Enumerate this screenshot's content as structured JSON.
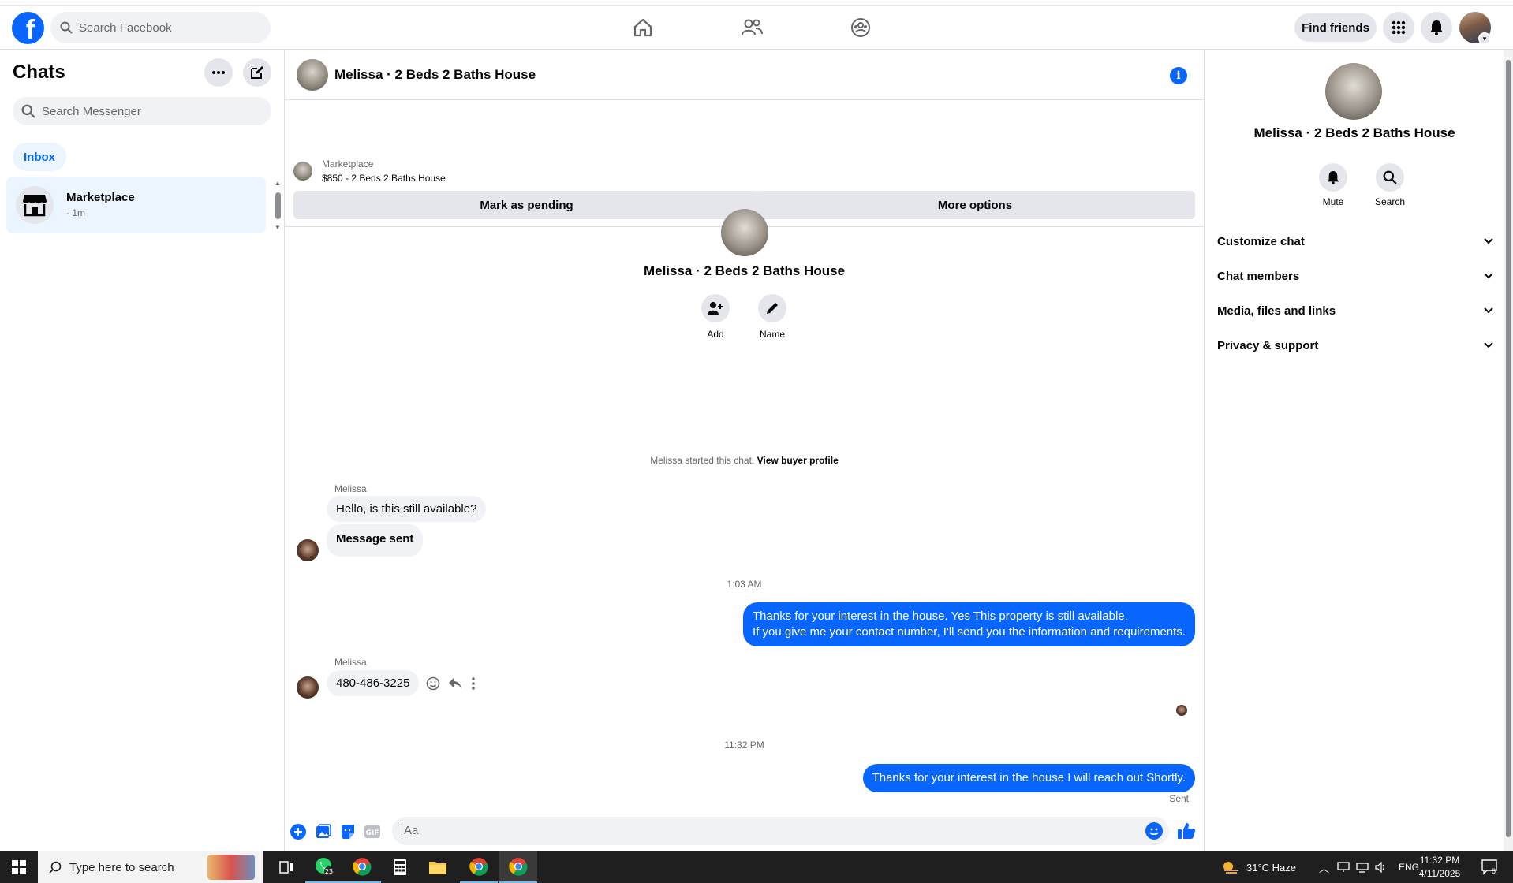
{
  "nav": {
    "logo": "f",
    "search_placeholder": "Search Facebook",
    "find_friends": "Find friends"
  },
  "left": {
    "title": "Chats",
    "search_placeholder": "Search Messenger",
    "inbox": "Inbox",
    "chat_item": {
      "name": "Marketplace",
      "time": "· 1m"
    }
  },
  "conversation": {
    "title": "Melissa · 2 Beds 2 Baths House",
    "marketplace_label": "Marketplace",
    "listing": "$850 - 2 Beds 2 Baths House",
    "mark_pending": "Mark as pending",
    "more_options": "More options",
    "profile_name": "Melissa · 2 Beds 2 Baths House",
    "add_label": "Add",
    "name_label": "Name",
    "started_text": "Melissa started this chat.",
    "view_buyer_profile": "View buyer profile",
    "sender_name": "Melissa",
    "msg1": "Hello, is this still available?",
    "msg2": "Message sent",
    "time1": "1:03 AM",
    "out1_line1": "Thanks for your interest in the house. Yes This property is still available.",
    "out1_line2": "If you give me your contact number, I'll send you the information and requirements.",
    "sender_name2": "Melissa",
    "msg3": "480-486-3225",
    "time2": "11:32 PM",
    "out2": "Thanks for your interest in the house I will reach out Shortly.",
    "sent": "Sent",
    "composer_placeholder": "Aa"
  },
  "right": {
    "name": "Melissa · 2 Beds 2 Baths House",
    "mute": "Mute",
    "search": "Search",
    "rows": [
      "Customize chat",
      "Chat members",
      "Media, files and links",
      "Privacy & support"
    ]
  },
  "taskbar": {
    "search_placeholder": "Type here to search",
    "whatsapp_badge": "23",
    "weather": "31°C  Haze",
    "lang": "ENG",
    "time": "11:32 PM",
    "date": "4/11/2025",
    "notif_count": "8"
  },
  "colors": {
    "accent": "#0866ff",
    "bubble_in": "#f0f2f5",
    "taskbar": "#1f1f1f"
  }
}
